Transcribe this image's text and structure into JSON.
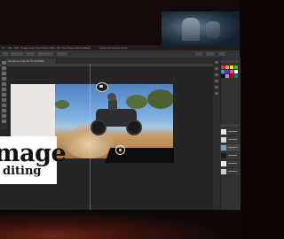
{
  "backdrop": {
    "accent": "#6a2415"
  },
  "menubar": {
    "items": [
      "Ps",
      "File",
      "Edit",
      "Image",
      "Layer",
      "Type",
      "Select",
      "Filter",
      "3D",
      "View",
      "Plugins",
      "Window",
      "Help"
    ],
    "title": "Adobe Photoshop 2022"
  },
  "document": {
    "tab_label": "Title Design.psd @ 66.7% (RGB/8)",
    "heading_line1": "mage",
    "heading_line2": "diting"
  },
  "swatches": [
    "#ff2a2a",
    "#ff9c00",
    "#ffe600",
    "#36c23a",
    "#1aa0ff",
    "#6a2bd6",
    "#ff3fa4",
    "#ffffff",
    "#000000",
    "#a0a0a0",
    "#c00000",
    "#008080"
  ],
  "icons": {
    "target": "target-icon",
    "rider_badge": "circle-icon"
  }
}
